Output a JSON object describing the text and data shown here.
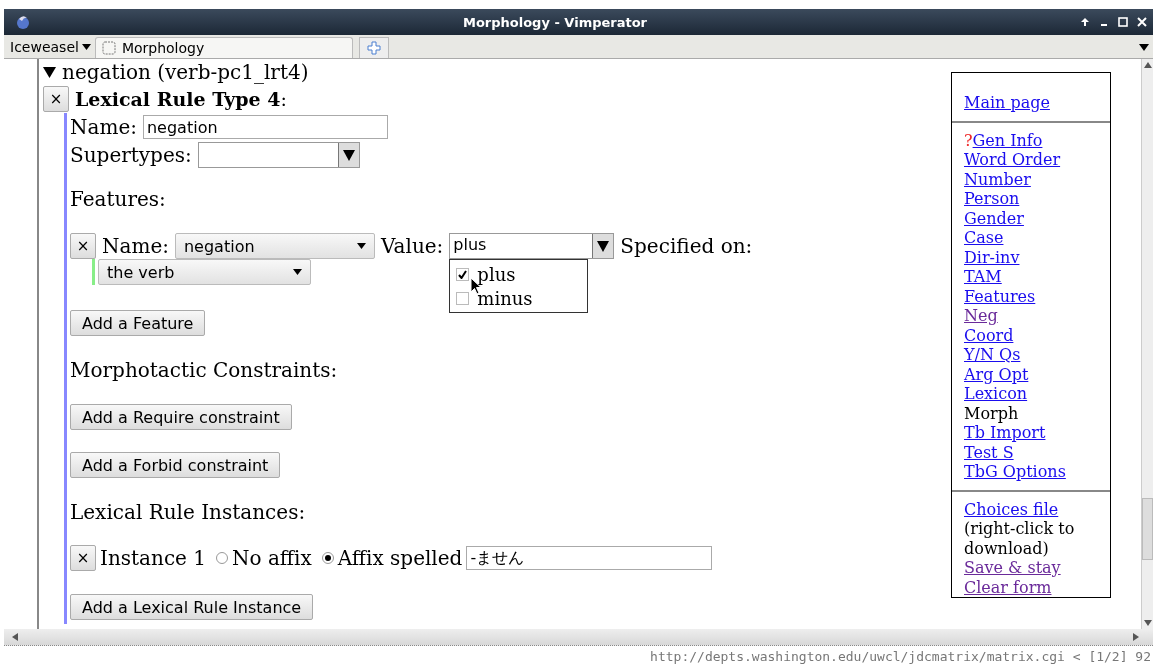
{
  "window": {
    "title": "Morphology - Vimperator"
  },
  "tabbar": {
    "menu": "Iceweasel",
    "tabs": [
      {
        "label": "Morphology",
        "selected": true
      }
    ]
  },
  "section": {
    "title": "negation (verb-pc1_lrt4)",
    "expanded": true,
    "rule": {
      "delete": "×",
      "title": "**Lexical Rule Type 4**:",
      "name_label": "Name:",
      "name_value": "negation",
      "supertypes_label": "Supertypes:",
      "features_heading": "Features:",
      "features": [
        {
          "delete": "×",
          "name_label": "Name:",
          "name_value": "negation",
          "value_label": "Value:",
          "value": "plus",
          "dropdown_open": true,
          "options": [
            {
              "label": "plus",
              "checked": true
            },
            {
              "label": "minus",
              "checked": false
            }
          ],
          "specified_label": "Specified on:",
          "specified_value": "the verb"
        }
      ],
      "add_feature": "Add a Feature",
      "morphotactic_heading": "Morphotactic Constraints:",
      "add_require": "Add a Require constraint",
      "add_forbid": "Add a Forbid constraint",
      "instances_heading": "Lexical Rule Instances:",
      "instances": [
        {
          "delete": "×",
          "label": "Instance 1",
          "options": [
            {
              "label": "No affix",
              "selected": false
            },
            {
              "label": "Affix spelled",
              "selected": true
            }
          ],
          "affix": "-ません"
        }
      ],
      "add_instance": "Add a Lexical Rule Instance"
    }
  },
  "sidebar": {
    "groups": [
      [
        {
          "label": "Main page",
          "kind": "link",
          "visited": false
        }
      ],
      [
        {
          "label": "Gen Info",
          "kind": "link",
          "visited": false,
          "marker": "?"
        },
        {
          "label": "Word Order",
          "kind": "link",
          "visited": false
        },
        {
          "label": "Number",
          "kind": "link",
          "visited": false
        },
        {
          "label": "Person",
          "kind": "link",
          "visited": false
        },
        {
          "label": "Gender",
          "kind": "link",
          "visited": false
        },
        {
          "label": "Case",
          "kind": "link",
          "visited": false
        },
        {
          "label": "Dir-inv",
          "kind": "link",
          "visited": false
        },
        {
          "label": "TAM",
          "kind": "link",
          "visited": false
        },
        {
          "label": "Features",
          "kind": "link",
          "visited": false
        },
        {
          "label": "Neg",
          "kind": "link",
          "visited": true
        },
        {
          "label": "Coord",
          "kind": "link",
          "visited": false
        },
        {
          "label": "Y/N Qs",
          "kind": "link",
          "visited": false
        },
        {
          "label": "Arg Opt",
          "kind": "link",
          "visited": false
        },
        {
          "label": "Lexicon",
          "kind": "link",
          "visited": false
        },
        {
          "label": "Morph",
          "kind": "current"
        },
        {
          "label": "Tb Import",
          "kind": "link",
          "visited": false
        },
        {
          "label": "Test S",
          "kind": "link",
          "visited": false
        },
        {
          "label": "TbG Options",
          "kind": "link",
          "visited": false
        }
      ],
      [
        {
          "label": "Choices file",
          "kind": "link",
          "visited": false
        },
        {
          "label": "(right-click to download)",
          "kind": "text"
        },
        {
          "label": "Save & stay",
          "kind": "link",
          "visited": true
        },
        {
          "label": "Clear form",
          "kind": "link",
          "visited": true
        }
      ]
    ]
  },
  "status_bar": {
    "text": "http://depts.washington.edu/uwcl/jdcmatrix/matrix.cgi < [1/2] 92"
  }
}
